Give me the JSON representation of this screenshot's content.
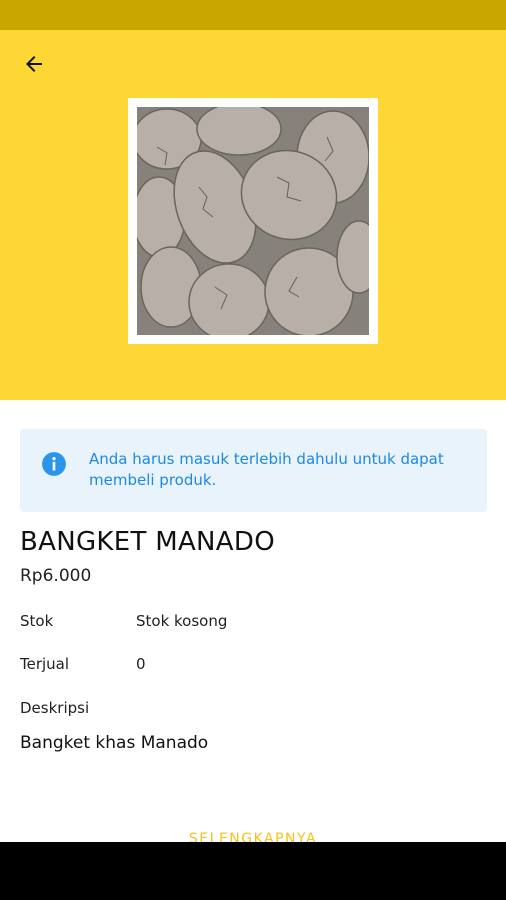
{
  "header": {
    "back_icon": "arrow-left-icon"
  },
  "product_image": {
    "alt": "Bangket Manado",
    "colors": {
      "background": "#fdd835",
      "status_bar": "#c9a700"
    }
  },
  "notice": {
    "icon": "info-icon",
    "text": "Anda harus masuk terlebih dahulu untuk dapat membeli produk.",
    "color": "#1e88e5",
    "background": "#e8f3fb"
  },
  "product": {
    "name": "BANGKET MANADO",
    "price": "Rp6.000",
    "details": [
      {
        "label": "Stok",
        "value": "Stok kosong"
      },
      {
        "label": "Terjual",
        "value": "0"
      }
    ],
    "description_label": "Deskripsi",
    "description": "Bangket khas Manado"
  },
  "actions": {
    "more_label": "SELENGKAPNYA",
    "accent": "#f6c21b"
  }
}
